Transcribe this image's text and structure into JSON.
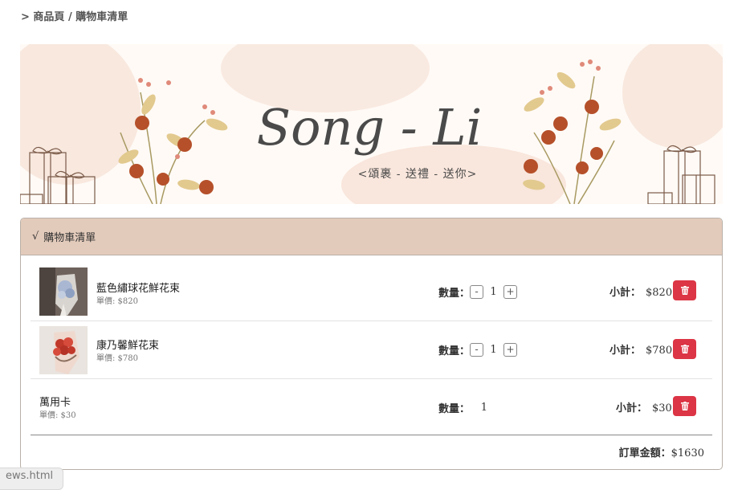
{
  "breadcrumb": "> 商品頁 / 購物車清單",
  "banner": {
    "title": "Song - Li",
    "subtitle": "<頌裹 - 送禮 - 送你>"
  },
  "cart": {
    "header_check": "√",
    "header_title": "購物車清單",
    "qty_label": "數量：",
    "subtotal_label": "小計：",
    "items": [
      {
        "name": "藍色繡球花鮮花束",
        "unit_price": "單價: $820",
        "qty": "1",
        "subtotal": "$820"
      },
      {
        "name": "康乃馨鮮花束",
        "unit_price": "單價: $780",
        "qty": "1",
        "subtotal": "$780"
      },
      {
        "name": "萬用卡",
        "unit_price": "單價: $30",
        "qty": "1",
        "subtotal": "$30"
      }
    ],
    "minus_label": "-",
    "plus_label": "+",
    "total_label": "訂單金額：",
    "total_value": "$1630"
  },
  "footer_tab": "ews.html",
  "colors": {
    "header_bg": "#e3cbbb",
    "delete_button": "#dc3545"
  },
  "icons": [
    "trash-icon",
    "flower-bouquet-image",
    "gift-box-illustration"
  ]
}
